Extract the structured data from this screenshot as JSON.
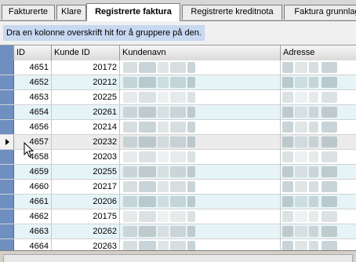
{
  "tabs": [
    {
      "label": "Fakturerte",
      "active": false
    },
    {
      "label": "Klare",
      "active": false
    },
    {
      "label": "Registrerte faktura",
      "active": true
    },
    {
      "label": "Registrerte kreditnota",
      "active": false
    },
    {
      "label": "Faktura grunnlag",
      "active": false
    }
  ],
  "group_hint": "Dra en kolonne overskrift hit for å gruppere på den.",
  "columns": {
    "id": "ID",
    "kunde_id": "Kunde ID",
    "kundenavn": "Kundenavn",
    "adresse": "Adresse"
  },
  "rows": [
    {
      "id": "4651",
      "kunde_id": "20172"
    },
    {
      "id": "4652",
      "kunde_id": "20212"
    },
    {
      "id": "4653",
      "kunde_id": "20225"
    },
    {
      "id": "4654",
      "kunde_id": "20261"
    },
    {
      "id": "4656",
      "kunde_id": "20214"
    },
    {
      "id": "4657",
      "kunde_id": "20232"
    },
    {
      "id": "4658",
      "kunde_id": "20203"
    },
    {
      "id": "4659",
      "kunde_id": "20255"
    },
    {
      "id": "4660",
      "kunde_id": "20217"
    },
    {
      "id": "4661",
      "kunde_id": "20206"
    },
    {
      "id": "4662",
      "kunde_id": "20175"
    },
    {
      "id": "4663",
      "kunde_id": "20262"
    },
    {
      "id": "4664",
      "kunde_id": "20263"
    }
  ],
  "current_row_index": 5,
  "colors": {
    "row_alt": "#e6f4f7",
    "row_normal": "#ffffff",
    "row_current": "#ececec",
    "selector": "#6e8fc0",
    "group_hint_bg": "#c8d8f0"
  }
}
